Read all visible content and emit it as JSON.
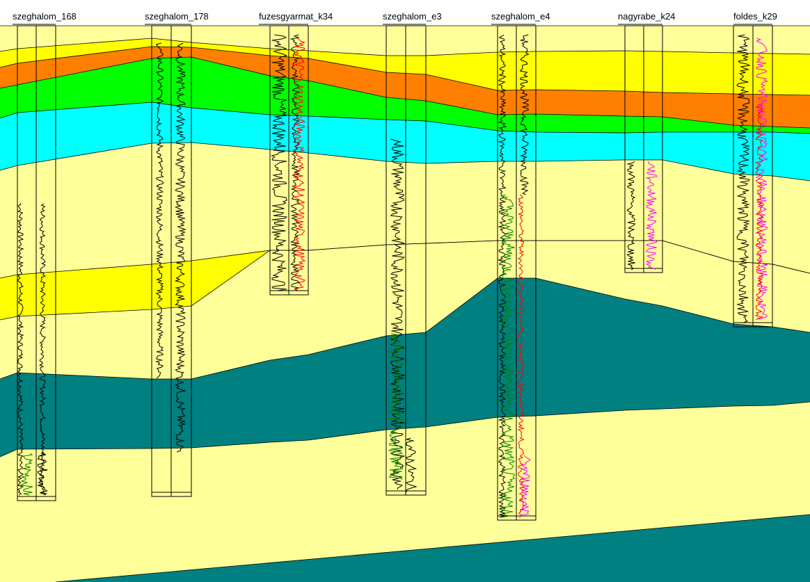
{
  "wells": [
    {
      "name": "szeghalom_168"
    },
    {
      "name": "szeghalom_178"
    },
    {
      "name": "fuzesgyarmat_k34"
    },
    {
      "name": "szeghalom_e3"
    },
    {
      "name": "szeghalom_e4"
    },
    {
      "name": "nagyrabe_k24"
    },
    {
      "name": "foldes_k29"
    }
  ],
  "colors": {
    "pale_yellow": "#ffff99",
    "yellow": "#ffff00",
    "orange": "#ff8000",
    "green": "#00ff00",
    "cyan": "#00ffff",
    "teal": "#008080",
    "log_black": "#000000",
    "log_green": "#008000",
    "log_red": "#ff0000",
    "log_magenta": "#ff00ff"
  }
}
